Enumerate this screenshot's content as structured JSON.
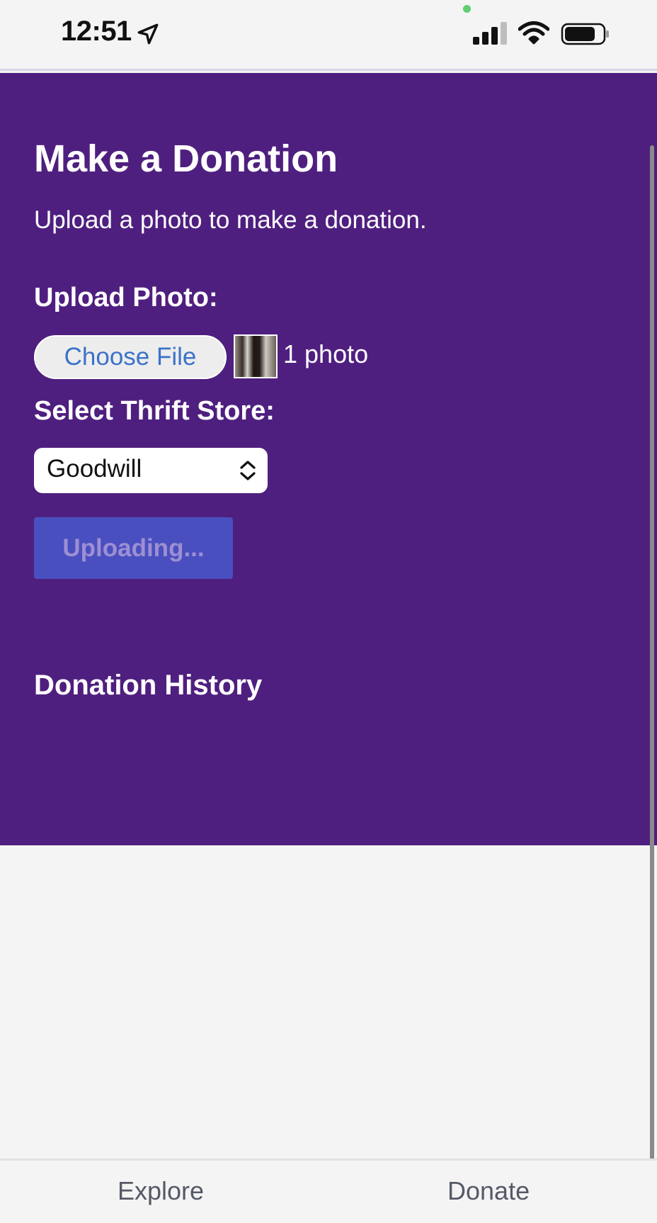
{
  "status_bar": {
    "time": "12:51"
  },
  "main": {
    "title": "Make a Donation",
    "subtitle": "Upload a photo to make a donation.",
    "upload_label": "Upload Photo:",
    "choose_file_label": "Choose File",
    "photo_count": "1 photo",
    "store_label": "Select Thrift Store:",
    "store_selected": "Goodwill",
    "upload_button_label": "Uploading...",
    "history_title": "Donation History"
  },
  "tabs": [
    {
      "label": "Explore"
    },
    {
      "label": "Donate"
    }
  ],
  "colors": {
    "panel_bg": "#4f1f7f",
    "upload_button_bg": "#4a4fbf",
    "link_blue": "#3b73c9"
  }
}
